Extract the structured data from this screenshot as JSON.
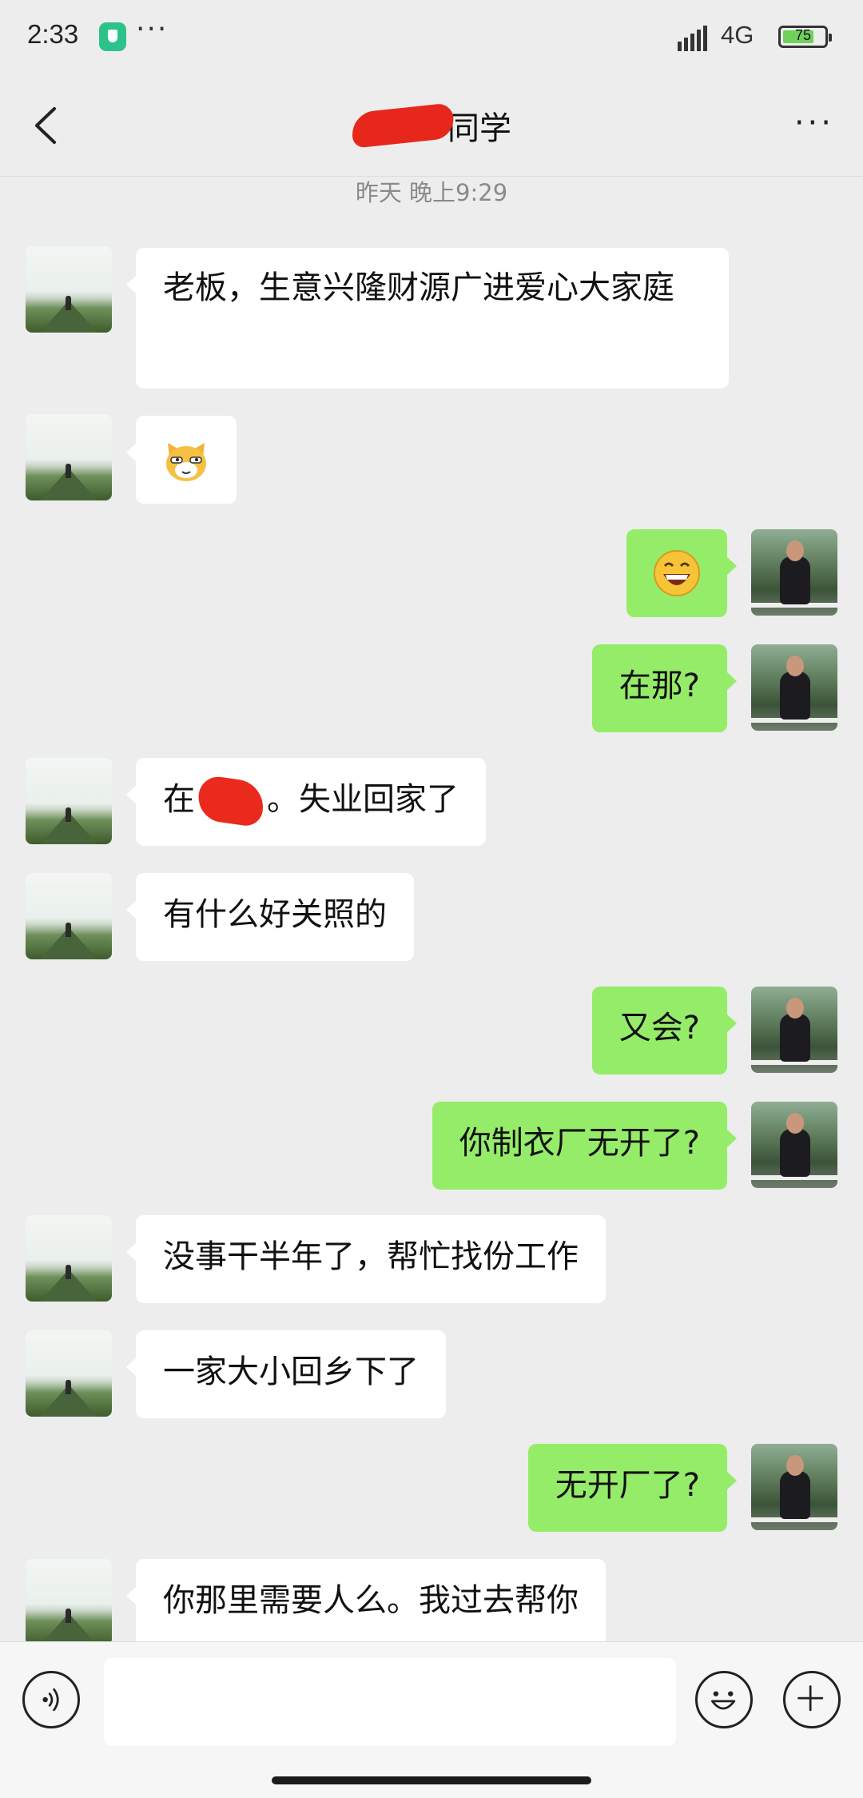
{
  "status_bar": {
    "time": "2:33",
    "more_dots": "···",
    "network": "4G",
    "battery_level": "75",
    "battery_fraction": 0.75
  },
  "nav": {
    "title_suffix": "同学",
    "more": "···"
  },
  "timestamp": "昨天 晚上9:29",
  "messages": [
    {
      "side": "left",
      "text": "老板，生意兴隆财源广进爱心大家庭"
    },
    {
      "side": "left",
      "type": "emoji",
      "icon": "cat-face-emoji"
    },
    {
      "side": "right",
      "type": "emoji",
      "icon": "grin-emoji"
    },
    {
      "side": "right",
      "text": "在那?"
    },
    {
      "side": "left",
      "text_before": "在",
      "text_after": "。失业回家了"
    },
    {
      "side": "left",
      "text": "有什么好关照的"
    },
    {
      "side": "right",
      "text": "又会?"
    },
    {
      "side": "right",
      "text": "你制衣厂无开了?"
    },
    {
      "side": "left",
      "text": "没事干半年了，帮忙找份工作"
    },
    {
      "side": "left",
      "text": "一家大小回乡下了"
    },
    {
      "side": "right",
      "text": "无开厂了?"
    },
    {
      "side": "left",
      "text": "你那里需要人么。我过去帮你"
    }
  ],
  "input": {
    "placeholder": ""
  },
  "colors": {
    "self_bubble": "#95ec69",
    "other_bubble": "#ffffff",
    "background": "#ededed",
    "redaction": "#e7271b"
  }
}
